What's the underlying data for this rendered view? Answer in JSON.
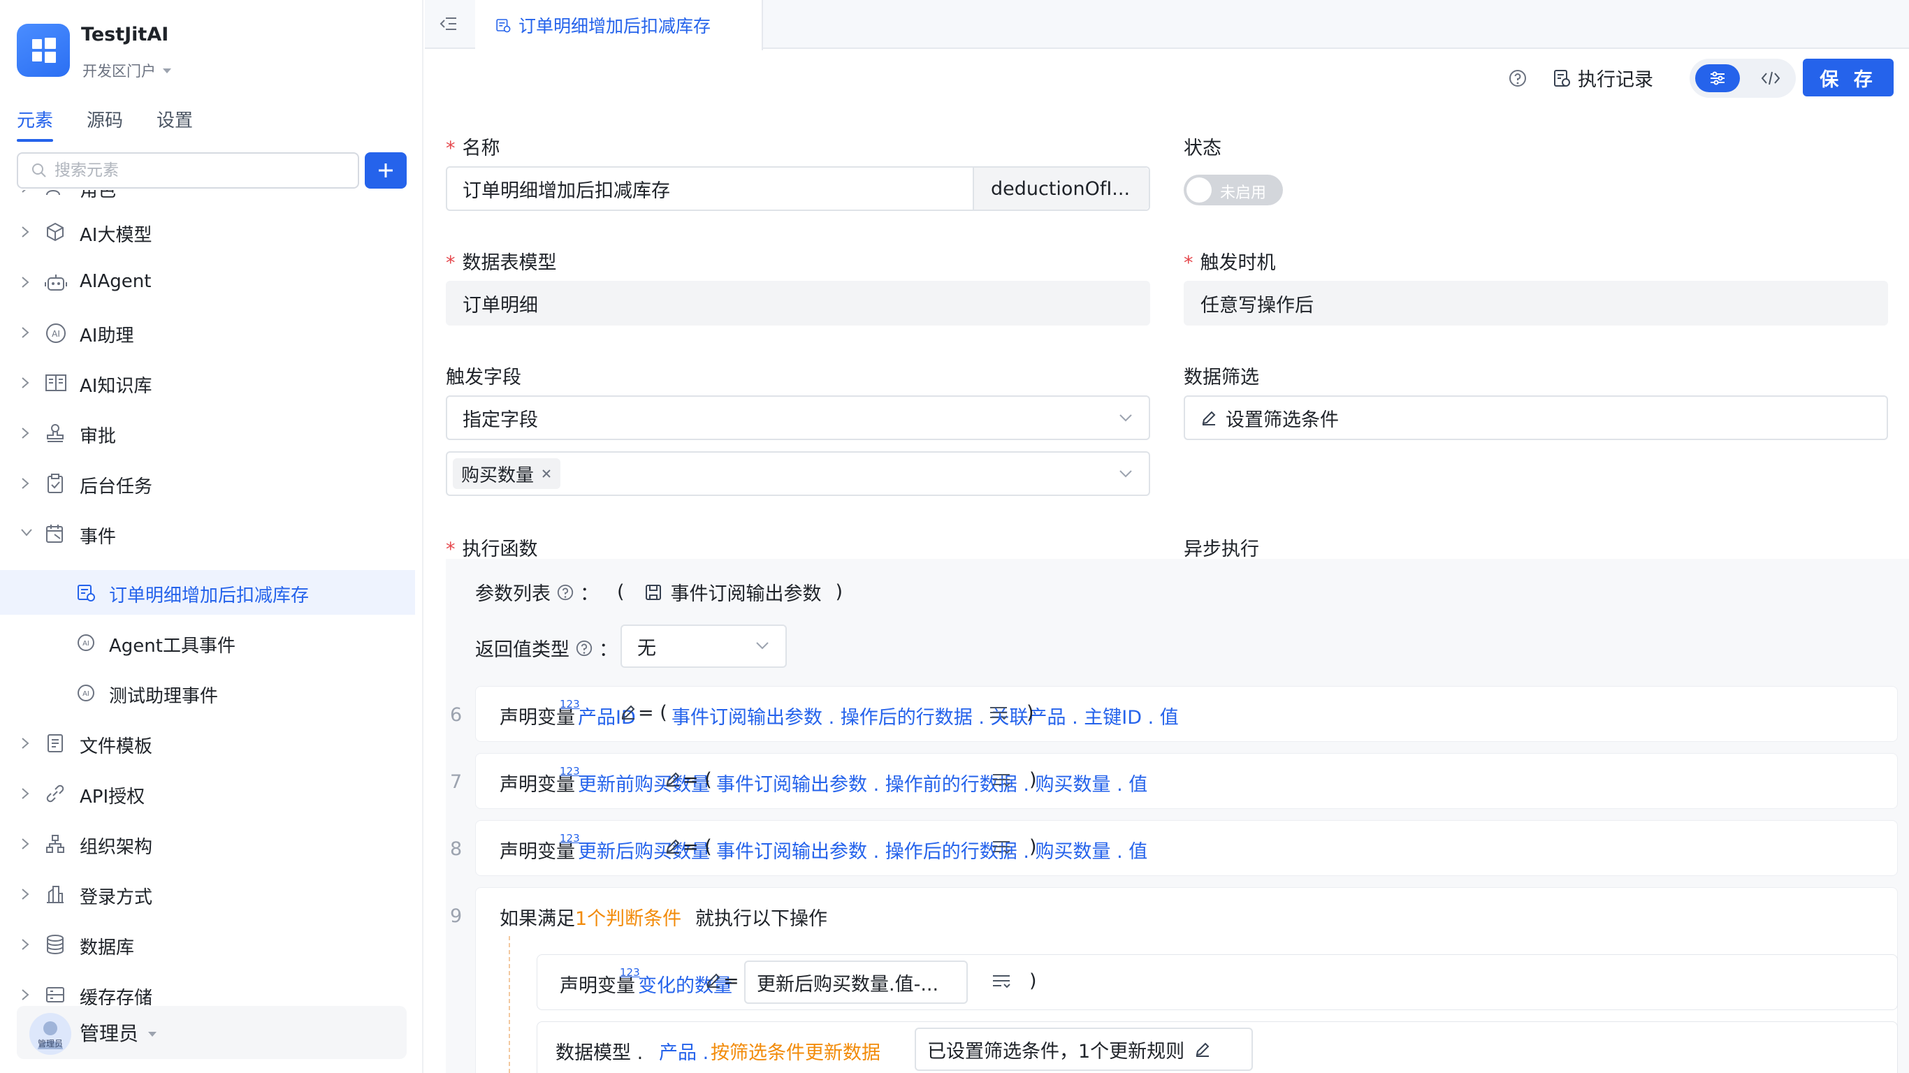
{
  "app": {
    "name": "TestJitAI",
    "portal": "开发区门户"
  },
  "sidebar": {
    "tabs": [
      {
        "label": "元素"
      },
      {
        "label": "源码"
      },
      {
        "label": "设置"
      }
    ],
    "search_placeholder": "搜索元素",
    "items": [
      {
        "label": "角色"
      },
      {
        "label": "AI大模型"
      },
      {
        "label": "AIAgent"
      },
      {
        "label": "AI助理"
      },
      {
        "label": "AI知识库"
      },
      {
        "label": "审批"
      },
      {
        "label": "后台任务"
      },
      {
        "label": "事件"
      },
      {
        "label": "订单明细增加后扣减库存"
      },
      {
        "label": "Agent工具事件"
      },
      {
        "label": "测试助理事件"
      },
      {
        "label": "文件模板"
      },
      {
        "label": "API授权"
      },
      {
        "label": "组织架构"
      },
      {
        "label": "登录方式"
      },
      {
        "label": "数据库"
      },
      {
        "label": "缓存存储"
      }
    ],
    "user": {
      "name": "管理员",
      "avatar_label": "管理员"
    }
  },
  "main": {
    "tab_title": "订单明细增加后扣减库存",
    "toolbar": {
      "history": "执行记录",
      "save": "保 存"
    },
    "form": {
      "name_label": "名称",
      "name_value": "订单明细增加后扣减库存",
      "name_code": "deductionOfI...",
      "status_label": "状态",
      "status_value": "未启用",
      "model_label": "数据表模型",
      "model_value": "订单明细",
      "trigger_label": "触发时机",
      "trigger_value": "任意写操作后",
      "field_label": "触发字段",
      "field_mode": "指定字段",
      "field_chip": "购买数量",
      "filter_label": "数据筛选",
      "filter_button": "设置筛选条件",
      "fn_label": "执行函数",
      "async_label": "异步执行"
    },
    "function": {
      "params_label": "参数列表",
      "params_colon": "：",
      "paren_open": "(",
      "paren_close": ")",
      "params_value": "事件订阅输出参数",
      "return_label": "返回值类型",
      "return_value": "无",
      "lines": [
        {
          "num": "6",
          "kw": "声明变量",
          "badge": "123",
          "var": "产品ID",
          "eq": "= (",
          "expr": "事件订阅输出参数 . 操作后的行数据 . 关联产品 . 主键ID . 值",
          "close": ")"
        },
        {
          "num": "7",
          "kw": "声明变量",
          "badge": "123",
          "var": "更新前购买数量",
          "eq": "= (",
          "expr": "事件订阅输出参数 . 操作前的行数据 . 购买数量 . 值",
          "close": ")"
        },
        {
          "num": "8",
          "kw": "声明变量",
          "badge": "123",
          "var": "更新后购买数量",
          "eq": "= (",
          "expr": "事件订阅输出参数 . 操作后的行数据 . 购买数量 . 值",
          "close": ")"
        }
      ],
      "if_line": {
        "num": "9",
        "prefix": "如果满足",
        "cond": "1个判断条件",
        "suffix": "就执行以下操作"
      },
      "inner_decl": {
        "kw": "声明变量",
        "badge": "123",
        "var": "变化的数量",
        "eq": "= (",
        "value": "更新后购买数量.值-...",
        "close": ")"
      },
      "inner_model": {
        "prefix": "数据模型 .",
        "model": "产品 .",
        "action": "按筛选条件更新数据",
        "value": "已设置筛选条件，1个更新规则"
      }
    }
  },
  "colors": {
    "accent": "#2563eb",
    "orange": "#f28b0a",
    "required": "#e5484d"
  }
}
